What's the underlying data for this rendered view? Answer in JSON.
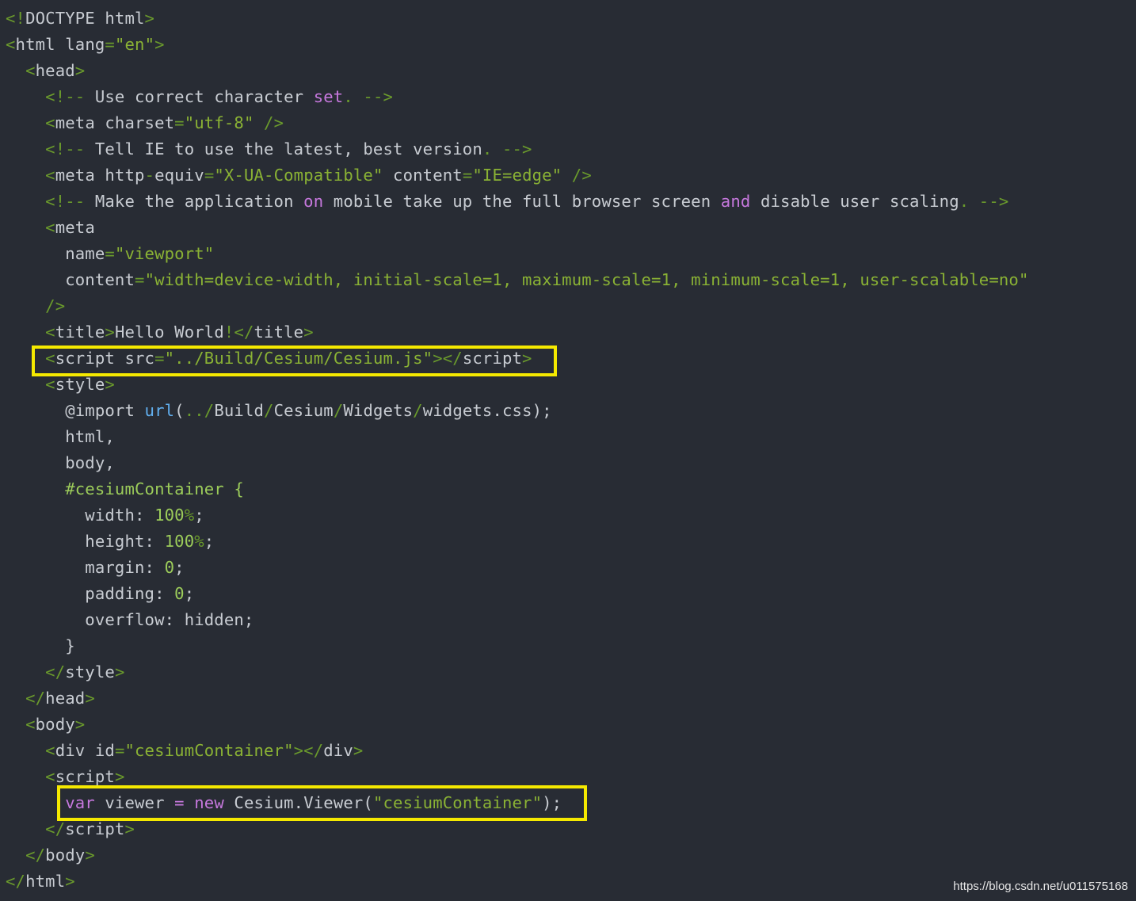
{
  "code": {
    "lines": [
      [
        [
          "p",
          "<!"
        ],
        [
          "t",
          "DOCTYPE html"
        ],
        [
          "p",
          ">"
        ]
      ],
      [
        [
          "p",
          "<"
        ],
        [
          "t",
          "html lang"
        ],
        [
          "p",
          "="
        ],
        [
          "s",
          "\"en\""
        ],
        [
          "p",
          ">"
        ]
      ],
      [
        [
          "t",
          "  "
        ],
        [
          "p",
          "<"
        ],
        [
          "t",
          "head"
        ],
        [
          "p",
          ">"
        ]
      ],
      [
        [
          "t",
          "    "
        ],
        [
          "p",
          "<!-- "
        ],
        [
          "t",
          "Use correct character "
        ],
        [
          "k",
          "set"
        ],
        [
          "p",
          ". -->"
        ]
      ],
      [
        [
          "t",
          "    "
        ],
        [
          "p",
          "<"
        ],
        [
          "t",
          "meta charset"
        ],
        [
          "p",
          "="
        ],
        [
          "s",
          "\"utf-8\""
        ],
        [
          "t",
          " "
        ],
        [
          "p",
          "/>"
        ]
      ],
      [
        [
          "t",
          "    "
        ],
        [
          "p",
          "<!-- "
        ],
        [
          "t",
          "Tell IE to use the latest, best version"
        ],
        [
          "p",
          ". -->"
        ]
      ],
      [
        [
          "t",
          "    "
        ],
        [
          "p",
          "<"
        ],
        [
          "t",
          "meta http"
        ],
        [
          "p",
          "-"
        ],
        [
          "t",
          "equiv"
        ],
        [
          "p",
          "="
        ],
        [
          "s",
          "\"X-UA-Compatible\""
        ],
        [
          "t",
          " content"
        ],
        [
          "p",
          "="
        ],
        [
          "s",
          "\"IE=edge\""
        ],
        [
          "t",
          " "
        ],
        [
          "p",
          "/>"
        ]
      ],
      [
        [
          "t",
          "    "
        ],
        [
          "p",
          "<!-- "
        ],
        [
          "t",
          "Make the application "
        ],
        [
          "k",
          "on"
        ],
        [
          "t",
          " mobile take up the full browser screen "
        ],
        [
          "k",
          "and"
        ],
        [
          "t",
          " disable user scaling"
        ],
        [
          "p",
          ". -->"
        ]
      ],
      [
        [
          "t",
          "    "
        ],
        [
          "p",
          "<"
        ],
        [
          "t",
          "meta"
        ]
      ],
      [
        [
          "t",
          "      name"
        ],
        [
          "p",
          "="
        ],
        [
          "s",
          "\"viewport\""
        ]
      ],
      [
        [
          "t",
          "      content"
        ],
        [
          "p",
          "="
        ],
        [
          "s",
          "\"width=device-width, initial-scale=1, maximum-scale=1, minimum-scale=1, user-scalable=no\""
        ]
      ],
      [
        [
          "t",
          "    "
        ],
        [
          "p",
          "/>"
        ]
      ],
      [
        [
          "t",
          "    "
        ],
        [
          "p",
          "<"
        ],
        [
          "t",
          "title"
        ],
        [
          "p",
          ">"
        ],
        [
          "t",
          "Hello World"
        ],
        [
          "p",
          "!</"
        ],
        [
          "t",
          "title"
        ],
        [
          "p",
          ">"
        ]
      ],
      [
        [
          "t",
          "    "
        ],
        [
          "p",
          "<"
        ],
        [
          "t",
          "script src"
        ],
        [
          "p",
          "="
        ],
        [
          "s",
          "\"../Build/Cesium/Cesium.js\""
        ],
        [
          "p",
          "></"
        ],
        [
          "t",
          "script"
        ],
        [
          "p",
          ">"
        ]
      ],
      [
        [
          "t",
          "    "
        ],
        [
          "p",
          "<"
        ],
        [
          "t",
          "style"
        ],
        [
          "p",
          ">"
        ]
      ],
      [
        [
          "t",
          "      @import "
        ],
        [
          "f",
          "url"
        ],
        [
          "t",
          "("
        ],
        [
          "p",
          "../"
        ],
        [
          "t",
          "Build"
        ],
        [
          "p",
          "/"
        ],
        [
          "t",
          "Cesium"
        ],
        [
          "p",
          "/"
        ],
        [
          "t",
          "Widgets"
        ],
        [
          "p",
          "/"
        ],
        [
          "t",
          "widgets.css);"
        ]
      ],
      [
        [
          "t",
          "      html,"
        ]
      ],
      [
        [
          "t",
          "      body,"
        ]
      ],
      [
        [
          "t",
          "      "
        ],
        [
          "n",
          "#cesiumContainer {"
        ]
      ],
      [
        [
          "t",
          "        width: "
        ],
        [
          "n",
          "100"
        ],
        [
          "p",
          "%"
        ],
        [
          "t",
          ";"
        ]
      ],
      [
        [
          "t",
          "        height: "
        ],
        [
          "n",
          "100"
        ],
        [
          "p",
          "%"
        ],
        [
          "t",
          ";"
        ]
      ],
      [
        [
          "t",
          "        margin: "
        ],
        [
          "n",
          "0"
        ],
        [
          "t",
          ";"
        ]
      ],
      [
        [
          "t",
          "        padding: "
        ],
        [
          "n",
          "0"
        ],
        [
          "t",
          ";"
        ]
      ],
      [
        [
          "t",
          "        overflow: hidden;"
        ]
      ],
      [
        [
          "t",
          "      }"
        ]
      ],
      [
        [
          "t",
          "    "
        ],
        [
          "p",
          "</"
        ],
        [
          "t",
          "style"
        ],
        [
          "p",
          ">"
        ]
      ],
      [
        [
          "t",
          "  "
        ],
        [
          "p",
          "</"
        ],
        [
          "t",
          "head"
        ],
        [
          "p",
          ">"
        ]
      ],
      [
        [
          "t",
          "  "
        ],
        [
          "p",
          "<"
        ],
        [
          "t",
          "body"
        ],
        [
          "p",
          ">"
        ]
      ],
      [
        [
          "t",
          "    "
        ],
        [
          "p",
          "<"
        ],
        [
          "t",
          "div id"
        ],
        [
          "p",
          "="
        ],
        [
          "s",
          "\"cesiumContainer\""
        ],
        [
          "p",
          "></"
        ],
        [
          "t",
          "div"
        ],
        [
          "p",
          ">"
        ]
      ],
      [
        [
          "t",
          "    "
        ],
        [
          "p",
          "<"
        ],
        [
          "t",
          "script"
        ],
        [
          "p",
          ">"
        ]
      ],
      [
        [
          "t",
          "      "
        ],
        [
          "k",
          "var"
        ],
        [
          "t",
          " viewer "
        ],
        [
          "k",
          "="
        ],
        [
          "t",
          " "
        ],
        [
          "k",
          "new"
        ],
        [
          "t",
          " Cesium.Viewer("
        ],
        [
          "s",
          "\"cesiumContainer\""
        ],
        [
          "t",
          ");"
        ]
      ],
      [
        [
          "t",
          "    "
        ],
        [
          "p",
          "</"
        ],
        [
          "t",
          "script"
        ],
        [
          "p",
          ">"
        ]
      ],
      [
        [
          "t",
          "  "
        ],
        [
          "p",
          "</"
        ],
        [
          "t",
          "body"
        ],
        [
          "p",
          ">"
        ]
      ],
      [
        [
          "p",
          "</"
        ],
        [
          "t",
          "html"
        ],
        [
          "p",
          ">"
        ]
      ]
    ]
  },
  "highlights": {
    "box1": "script-src-highlight",
    "box2": "viewer-init-highlight",
    "color": "#f5e900"
  },
  "watermark": "https://blog.csdn.net/u011575168"
}
